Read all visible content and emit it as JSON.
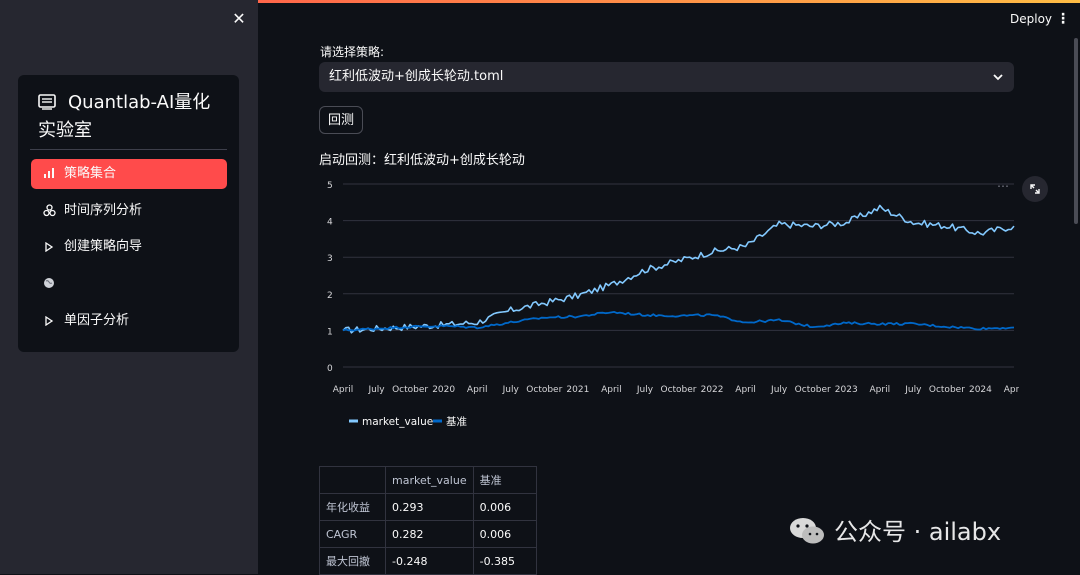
{
  "sidebar": {
    "title": "Quantlab-AI量化实验室",
    "items": [
      {
        "icon": "bar-chart-icon",
        "label": "策略集合",
        "active": true
      },
      {
        "icon": "molecule-icon",
        "label": "时间序列分析",
        "active": false
      },
      {
        "icon": "play-triangle-icon",
        "label": "创建策略向导",
        "active": false
      },
      {
        "icon": "globe-icon",
        "label": "",
        "active": false
      },
      {
        "icon": "play-triangle-icon",
        "label": "单因子分析",
        "active": false
      }
    ]
  },
  "header": {
    "deploy_label": "Deploy"
  },
  "main": {
    "select_label": "请选择策略:",
    "select_value": "红利低波动+创成长轮动.toml",
    "backtest_button": "回测",
    "start_text": "启动回测：红利低波动+创成长轮动"
  },
  "chart_data": {
    "type": "line",
    "title": "",
    "xlabel": "",
    "ylabel": "",
    "ylim": [
      0,
      5
    ],
    "yticks": [
      "0",
      "1",
      "2",
      "3",
      "4",
      "5"
    ],
    "xticks": [
      "April",
      "July",
      "October",
      "2020",
      "April",
      "July",
      "October",
      "2021",
      "April",
      "July",
      "October",
      "2022",
      "April",
      "July",
      "October",
      "2023",
      "April",
      "July",
      "October",
      "2024",
      "April"
    ],
    "x": [
      "2019-04",
      "2019-07",
      "2019-10",
      "2020-01",
      "2020-04",
      "2020-07",
      "2020-10",
      "2021-01",
      "2021-04",
      "2021-07",
      "2021-10",
      "2022-01",
      "2022-04",
      "2022-07",
      "2022-10",
      "2023-01",
      "2023-04",
      "2023-07",
      "2023-10",
      "2024-01",
      "2024-04"
    ],
    "series": [
      {
        "name": "market_value",
        "color": "#83c9ff",
        "values": [
          1.0,
          1.05,
          1.1,
          1.15,
          1.22,
          1.55,
          1.75,
          1.95,
          2.25,
          2.65,
          2.9,
          3.15,
          3.3,
          3.9,
          3.85,
          3.95,
          4.35,
          3.95,
          3.85,
          3.65,
          3.85
        ]
      },
      {
        "name": "基准",
        "color": "#0068c9",
        "values": [
          1.0,
          1.05,
          1.1,
          1.12,
          1.08,
          1.22,
          1.35,
          1.38,
          1.5,
          1.42,
          1.4,
          1.42,
          1.22,
          1.28,
          1.1,
          1.2,
          1.18,
          1.18,
          1.1,
          1.05,
          1.08
        ]
      }
    ],
    "grid": true,
    "legend": "bottom-left"
  },
  "table": {
    "headers": [
      "",
      "market_value",
      "基准"
    ],
    "rows": [
      [
        "年化收益",
        "0.293",
        "0.006"
      ],
      [
        "CAGR",
        "0.282",
        "0.006"
      ],
      [
        "最大回撤",
        "-0.248",
        "-0.385"
      ]
    ]
  },
  "watermark": "公众号 · ailabx"
}
